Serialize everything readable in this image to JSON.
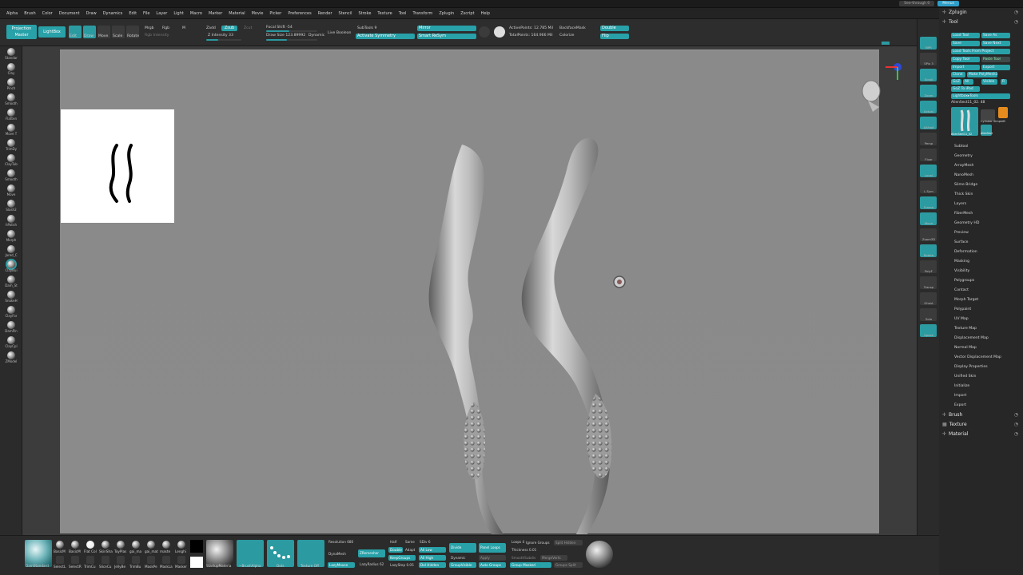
{
  "titlebar": {
    "see_through": "See-through 0",
    "menus": "Menus"
  },
  "menu": [
    "Alpha",
    "Brush",
    "Color",
    "Document",
    "Draw",
    "Dynamics",
    "Edit",
    "File",
    "Layer",
    "Light",
    "Macro",
    "Marker",
    "Material",
    "Movie",
    "Picker",
    "Preferences",
    "Render",
    "Stencil",
    "Stroke",
    "Texture",
    "Tool",
    "Transform",
    "Zplugin",
    "Zscript",
    "Help"
  ],
  "toolbar": {
    "projection_master": "Projection Master",
    "lightbox": "LightBox",
    "edit": "Edit",
    "draw": "Draw",
    "move": "Move",
    "scale": "Scale",
    "rotate": "Rotate",
    "mrgb": "Mrgb",
    "rgb": "Rgb",
    "m": "M",
    "rgb_intensity": "Rgb Intensity",
    "zadd": "Zadd",
    "zsub": "Zsub",
    "zcut": "Zcut",
    "z_intensity": "Z Intensity 33",
    "focal_shift": "Focal Shift -54",
    "draw_size": "Draw Size 123.89992",
    "dynamic": "Dynamic",
    "live_boolean": "Live Boolean",
    "subtools": "SubTools 9",
    "activate_symmetry": "Activate Symmetry",
    "mirror": "Mirror",
    "smart_resym": "Smart ReSym",
    "active_points": "ActivePoints: 12.785 Mil",
    "total_points": "TotalPoints: 164.966 Mil",
    "backface_mask": "BackfaceMask",
    "colorize": "Colorize",
    "double": "Double",
    "flip": "Flip"
  },
  "left_brushes": [
    "Standar",
    "Clay",
    "Pinch",
    "Smooth",
    "Flatten",
    "Move T",
    "TrimDy",
    "ClayTub",
    "Smooth",
    "Move",
    "Slash2",
    "hPolish",
    "Morph",
    "Jared_C",
    "ClayBui",
    "Dam_St",
    "SnakeH",
    "ClayFor",
    "DamPin",
    "ClayCpl",
    "ZModel"
  ],
  "right_icons": [
    "BPR",
    "SPix 3",
    "Scroll",
    "Zoom",
    "Actual",
    "AAHalf",
    "Persp",
    "Floor",
    "Local",
    "L.Sym",
    "Frame",
    "Move",
    "Zoom3D",
    "Rotate",
    "PolyF",
    "Transp",
    "Ghost",
    "Solo",
    "Xpose"
  ],
  "palette": {
    "zplugin": "Zplugin",
    "tool": "Tool",
    "buttons": [
      "Load Tool",
      "Save As",
      "Save",
      "Save Next",
      "Load Tools From Project",
      "Copy Tool",
      "Paste Tool",
      "Import",
      "Export",
      "Clone",
      "Make PolyMesh3D",
      "GoZ",
      "All",
      "Visible",
      "R",
      "GoZ To iPad",
      "Lightbox▸Tools"
    ],
    "current_tool": "AlienSect11_02. 48",
    "thumb_label_1": "AlienSect11_02",
    "thumb_label_2": "Cylinder SimpleB",
    "thumb_label_3": "AlienSect",
    "sections": [
      "Subtool",
      "Geometry",
      "ArrayMesh",
      "NanoMesh",
      "Slime Bridge",
      "Thick Skin",
      "Layers",
      "FiberMesh",
      "Geometry HD",
      "Preview",
      "Surface",
      "Deformation",
      "Masking",
      "Visibility",
      "Polygroups",
      "Contact",
      "Morph Target",
      "Polypaint",
      "UV Map",
      "Texture Map",
      "Displacement Map",
      "Normal Map",
      "Vector Displacement Map",
      "Display Properties",
      "Unified Skin",
      "Initialize",
      "Import",
      "Export"
    ],
    "brush": "Brush",
    "texture": "Texture",
    "material": "Material"
  },
  "bottom": {
    "brush_labels": [
      "BasicM",
      "BasicM",
      "Flat Col",
      "SkinSha",
      "ToyPlas",
      "gai_ma",
      "gai_mat",
      "maste",
      "Lenghi"
    ],
    "brush_labels2": [
      "SelectL",
      "SelectR",
      "TrimCu",
      "SliceCu",
      "JellyBe",
      "TrimBu",
      "MaskPe",
      "MaskLa",
      "Masker"
    ],
    "dam_standard": "DamStandard",
    "startup_material": "StartupMateria",
    "brush_alpha": "~BrushAlpha",
    "dots": "Dots",
    "texture_off": "Texture Off",
    "resolution": "Resolution 680",
    "dynamesh": "DynaMesh",
    "lazymouse": "LazyMouse",
    "zremesher": "ZRemesher",
    "half": "Half",
    "same": "Same",
    "double": "Double",
    "adapt": "Adapt",
    "keepgroups": "KeepGroups",
    "sdiv": "SDiv 6",
    "all_low": "All Low",
    "all_high": "All High",
    "del_hidden": "Del Hidden",
    "lazyradius": "LazyRadius 62",
    "lazystep": "LazyStep 0.05",
    "divide": "Divide",
    "dynamic": "Dynamic",
    "groupvisible": "GroupVisible",
    "panel_loops": "Panel Loops",
    "apply": "Apply",
    "auto_groups": "Auto Groups",
    "loops": "Loops 4",
    "ignore_groups": "Ignore Groups",
    "thickness": "Thickness 0.01",
    "smooth_subdiv": "SmoothSubdiv",
    "merge_verts": "MergeVerts",
    "group_masked": "Group Masked",
    "split_hidden": "Split Hidden",
    "groups_split": "Groups Split"
  }
}
